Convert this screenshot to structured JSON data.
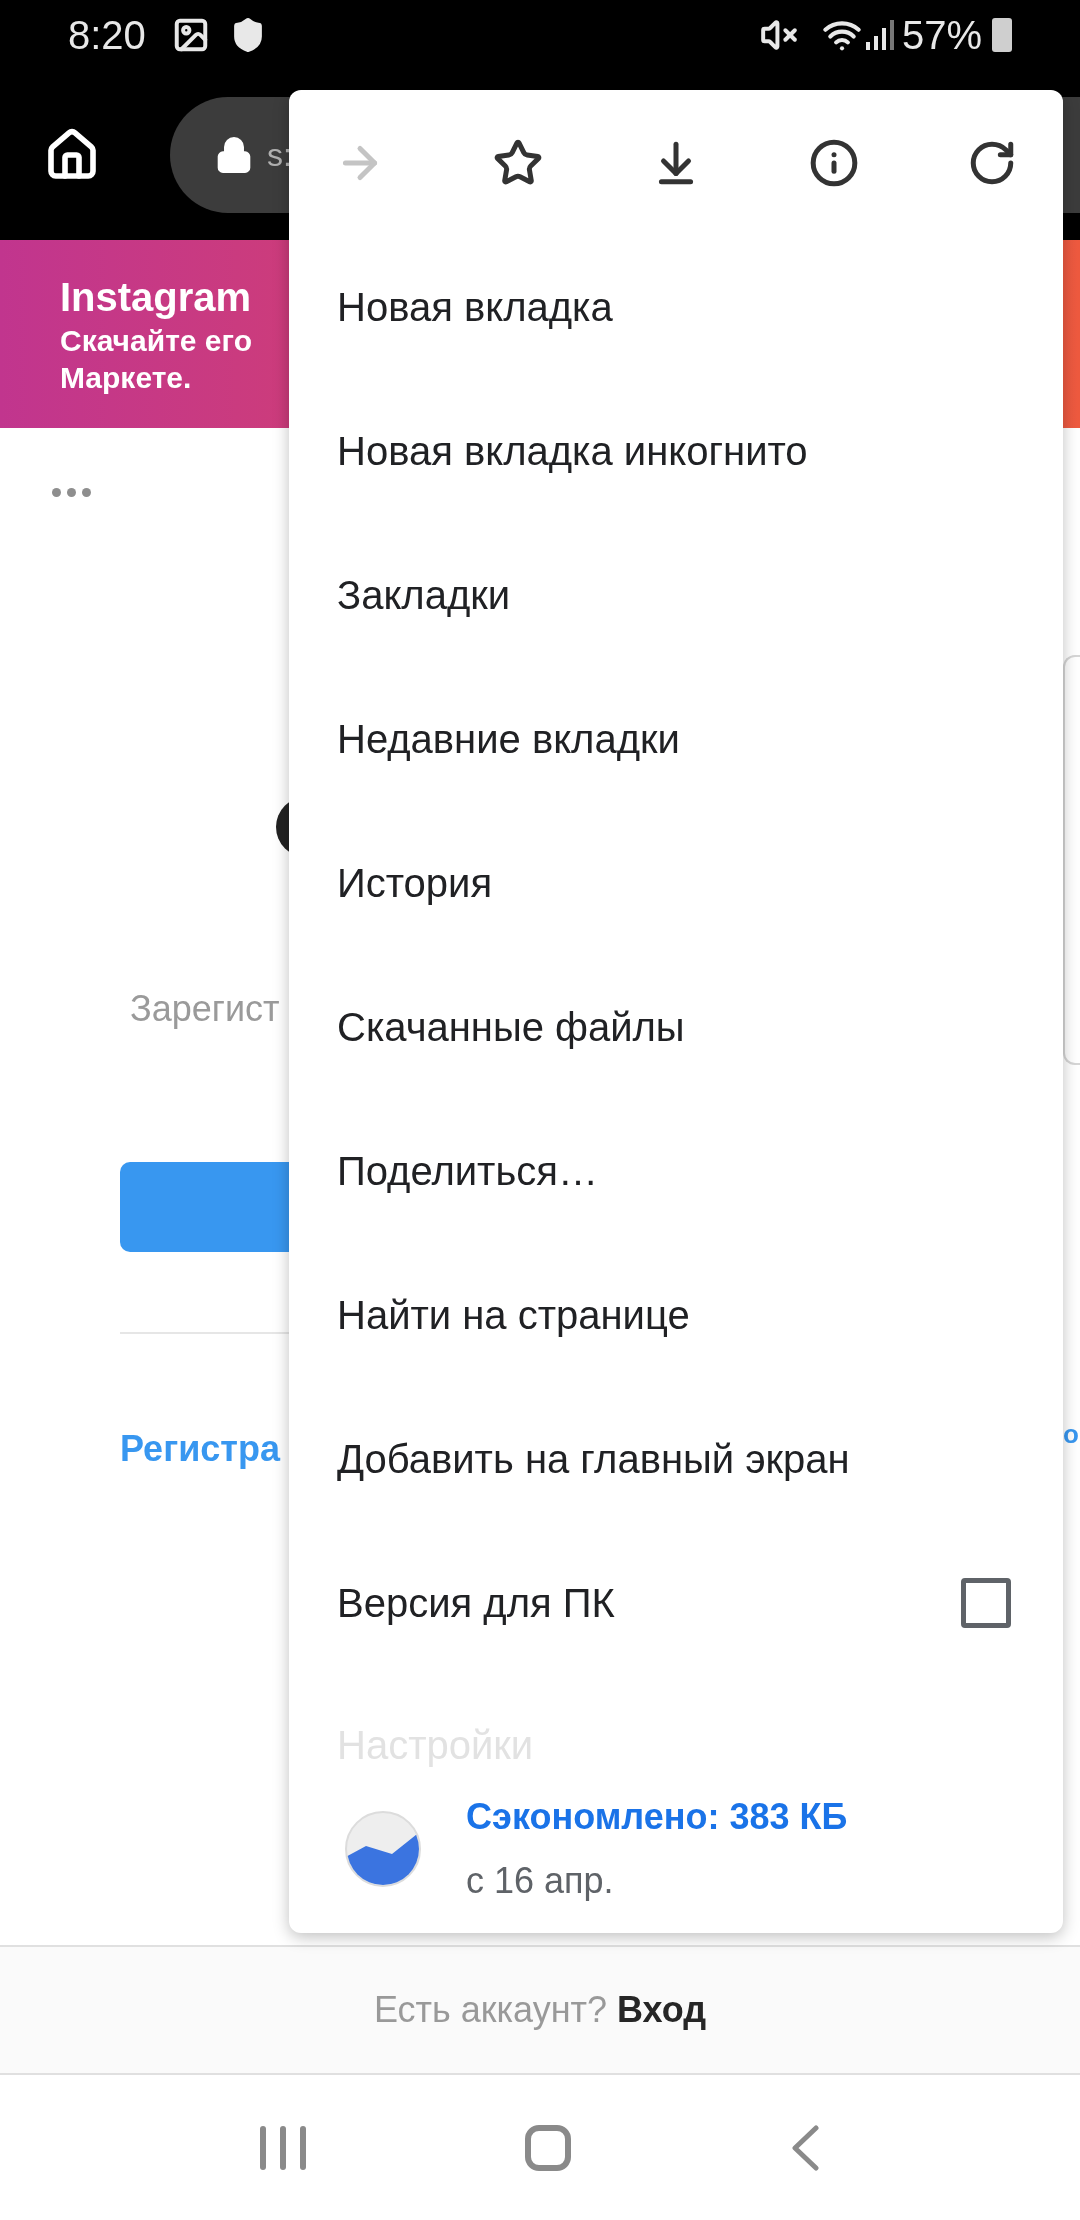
{
  "status_bar": {
    "time": "8:20",
    "battery": "57%"
  },
  "toolbar": {
    "url": "s:"
  },
  "banner": {
    "title": "Instagram",
    "line_1": "Скачайте его",
    "line_2": "Маркете."
  },
  "page": {
    "signup_text": "Зарегист",
    "signup_link": "Регистра",
    "right_link": "о"
  },
  "menu": {
    "icons": [
      {
        "kind": "forward",
        "disabled": true
      },
      {
        "kind": "bookmark",
        "disabled": false
      },
      {
        "kind": "download",
        "disabled": false
      },
      {
        "kind": "info",
        "disabled": false
      },
      {
        "kind": "refresh",
        "disabled": false
      }
    ],
    "items": [
      {
        "label": "Новая вкладка",
        "kind": "plain"
      },
      {
        "label": "Новая вкладка инкогнито",
        "kind": "plain"
      },
      {
        "label": "Закладки",
        "kind": "plain"
      },
      {
        "label": "Недавние вкладки",
        "kind": "plain"
      },
      {
        "label": "История",
        "kind": "plain"
      },
      {
        "label": "Скачанные файлы",
        "kind": "plain"
      },
      {
        "label": "Поделиться…",
        "kind": "plain"
      },
      {
        "label": "Найти на странице",
        "kind": "plain"
      },
      {
        "label": "Добавить на главный экран",
        "kind": "plain"
      },
      {
        "label": "Версия для ПК",
        "kind": "checkbox",
        "checked": false
      },
      {
        "label": "Настройки",
        "kind": "faded"
      }
    ],
    "savings": {
      "title": "Сэкономлено: 383 КБ",
      "since": "с 16 апр."
    }
  },
  "login_bar": {
    "text": "Есть аккаунт?",
    "link": "Вход"
  }
}
